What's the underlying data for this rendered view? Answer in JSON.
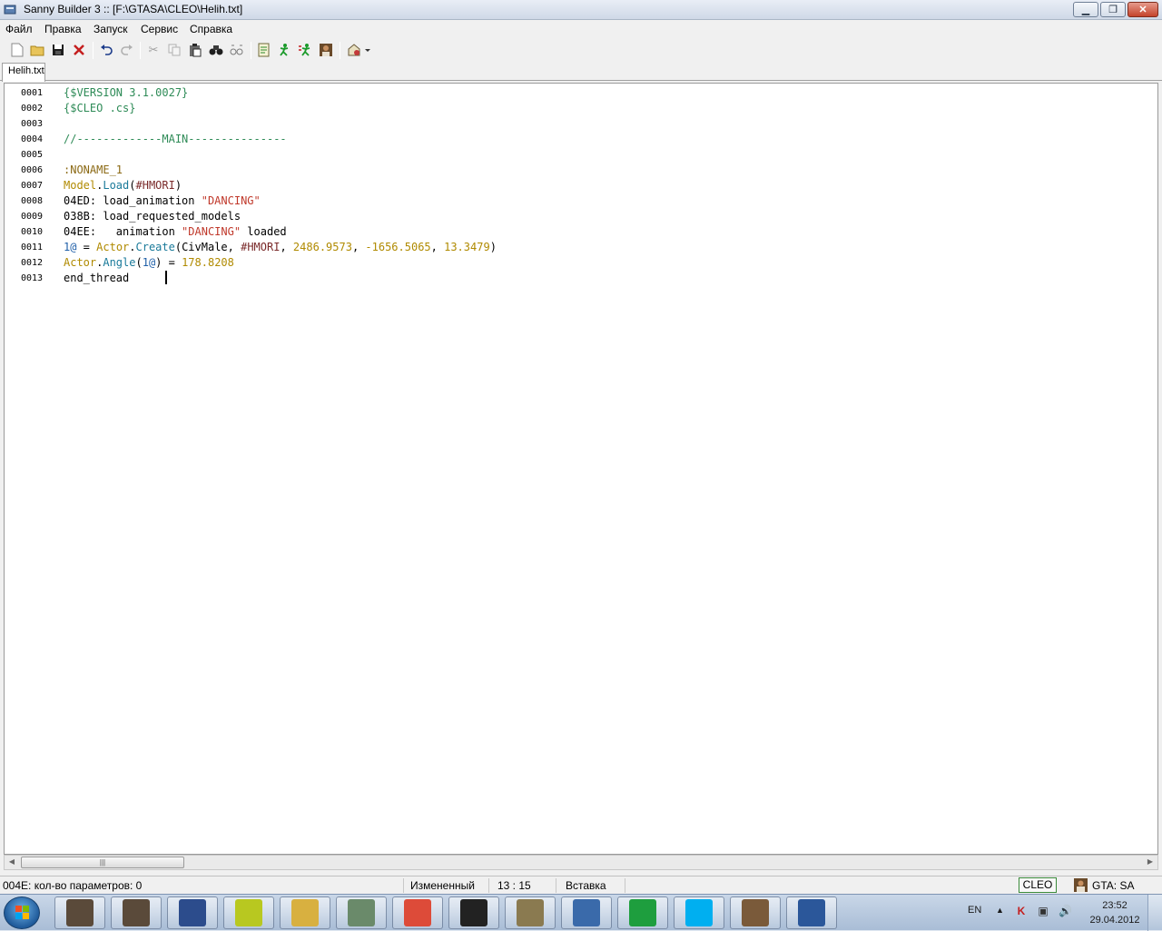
{
  "window": {
    "title": "Sanny Builder 3 :: [F:\\GTASA\\CLEO\\Helih.txt]"
  },
  "menu": [
    "Файл",
    "Правка",
    "Запуск",
    "Сервис",
    "Справка"
  ],
  "toolbar_icons": [
    "new-file-icon",
    "open-folder-icon",
    "save-icon",
    "close-file-icon",
    "undo-icon",
    "redo-icon",
    "cut-icon",
    "copy-icon",
    "paste-icon",
    "find-icon",
    "replace-icon",
    "compile-icon",
    "run-icon",
    "compile-run-icon",
    "game-icon",
    "tools-dropdown-icon"
  ],
  "tab": {
    "label": "Helih.txt"
  },
  "editor": {
    "lines": [
      {
        "n": "0001",
        "tokens": [
          [
            "{$VERSION 3.1.0027}",
            "comment"
          ]
        ]
      },
      {
        "n": "0002",
        "tokens": [
          [
            "{$CLEO .cs}",
            "comment"
          ]
        ]
      },
      {
        "n": "0003",
        "tokens": []
      },
      {
        "n": "0004",
        "tokens": [
          [
            "//-------------MAIN---------------",
            "comment"
          ]
        ]
      },
      {
        "n": "0005",
        "tokens": []
      },
      {
        "n": "0006",
        "tokens": [
          [
            ":NONAME_1",
            "label"
          ]
        ]
      },
      {
        "n": "0007",
        "tokens": [
          [
            "Model",
            "class"
          ],
          [
            ".",
            "plain"
          ],
          [
            "Load",
            "method"
          ],
          [
            "(",
            "plain"
          ],
          [
            "#HMORI",
            "model"
          ],
          [
            ")",
            "plain"
          ]
        ]
      },
      {
        "n": "0008",
        "tokens": [
          [
            "04ED: load_animation ",
            "plain"
          ],
          [
            "\"DANCING\"",
            "string"
          ]
        ]
      },
      {
        "n": "0009",
        "tokens": [
          [
            "038B: load_requested_models",
            "plain"
          ]
        ]
      },
      {
        "n": "0010",
        "tokens": [
          [
            "04EE:   animation ",
            "plain"
          ],
          [
            "\"DANCING\"",
            "string"
          ],
          [
            " loaded",
            "plain"
          ]
        ]
      },
      {
        "n": "0011",
        "tokens": [
          [
            "1@",
            "local"
          ],
          [
            " = ",
            "plain"
          ],
          [
            "Actor",
            "class"
          ],
          [
            ".",
            "plain"
          ],
          [
            "Create",
            "method"
          ],
          [
            "(CivMale, ",
            "plain"
          ],
          [
            "#HMORI",
            "model"
          ],
          [
            ", ",
            "plain"
          ],
          [
            "2486.9573",
            "number"
          ],
          [
            ", ",
            "plain"
          ],
          [
            "-1656.5065",
            "number"
          ],
          [
            ", ",
            "plain"
          ],
          [
            "13.3479",
            "number"
          ],
          [
            ")",
            "plain"
          ]
        ]
      },
      {
        "n": "0012",
        "tokens": [
          [
            "Actor",
            "class"
          ],
          [
            ".",
            "plain"
          ],
          [
            "Angle",
            "method"
          ],
          [
            "(",
            "plain"
          ],
          [
            "1@",
            "local"
          ],
          [
            ") = ",
            "plain"
          ],
          [
            "178.8208",
            "number"
          ]
        ]
      },
      {
        "n": "0013",
        "tokens": [
          [
            "end_thread",
            "plain"
          ]
        ]
      }
    ]
  },
  "status": {
    "hint": "004E: кол-во параметров: 0",
    "modified": "Измененный",
    "position": "13 : 15",
    "mode": "Вставка",
    "mode_cleo": "CLEO",
    "game": "GTA: SA"
  },
  "taskbar": {
    "apps": [
      {
        "icon": "cj-avatar-icon",
        "color": "#5a4a3a"
      },
      {
        "icon": "cj-avatar-icon",
        "color": "#5a4a3a"
      },
      {
        "icon": "pause-app-icon",
        "color": "#2c4c8c"
      },
      {
        "icon": "yellow-notes-icon",
        "color": "#b8c820"
      },
      {
        "icon": "folder-tools-icon",
        "color": "#d8b040"
      },
      {
        "icon": "document-viewer-icon",
        "color": "#6a8a6a"
      },
      {
        "icon": "chrome-icon",
        "color": "#dd4b39"
      },
      {
        "icon": "s-logo-icon",
        "color": "#222222"
      },
      {
        "icon": "gta-game-icon",
        "color": "#8a7a50"
      },
      {
        "icon": "sanny-builder-icon",
        "color": "#3a6aaa"
      },
      {
        "icon": "mail-agent-icon",
        "color": "#1e9e3e"
      },
      {
        "icon": "skype-icon",
        "color": "#00aff0"
      },
      {
        "icon": "gta-character-icon",
        "color": "#7a5a3a"
      },
      {
        "icon": "word-icon",
        "color": "#2b579a"
      }
    ],
    "lang": "EN",
    "time": "23:52",
    "date": "29.04.2012"
  }
}
